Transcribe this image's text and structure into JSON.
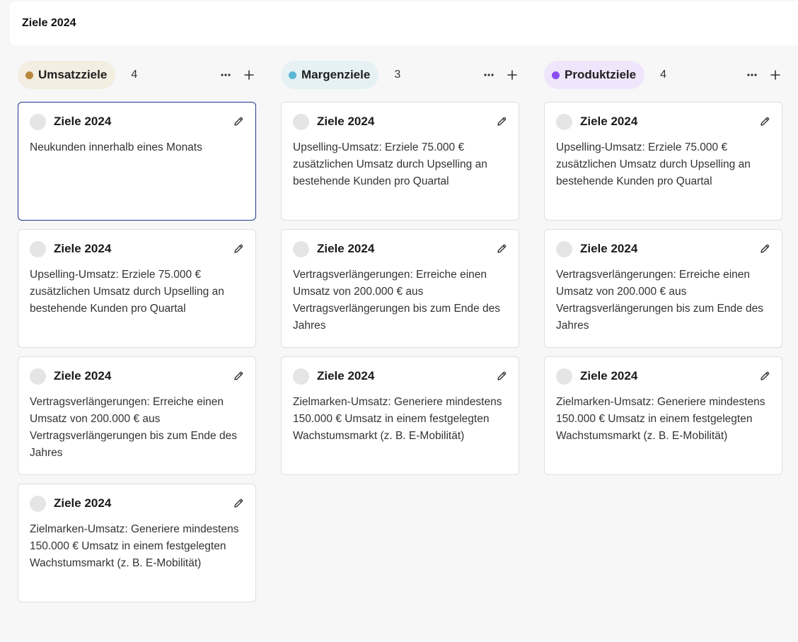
{
  "header": {
    "title": "Ziele 2024"
  },
  "columns": [
    {
      "label": "Umsatzziele",
      "count": "4",
      "dot_color": "#b8893a",
      "chip_bg": "#f3ede2",
      "cards": [
        {
          "title": "Ziele 2024",
          "text": "Neukunden innerhalb eines Monats"
        },
        {
          "title": "Ziele 2024",
          "text": "Upselling-Umsatz: Erziele 75.000 € zusätzlichen Umsatz durch Upselling an bestehende Kunden pro Quartal"
        },
        {
          "title": "Ziele 2024",
          "text": "Vertragsverlängerungen: Erreiche einen Umsatz von 200.000 € aus Vertragsverlängerungen bis zum Ende des Jahres"
        },
        {
          "title": "Ziele 2024",
          "text": "Zielmarken-Umsatz: Generiere mindestens 150.000 € Umsatz in einem festgelegten Wachstumsmarkt (z. B. E-Mobilität)"
        }
      ]
    },
    {
      "label": "Margenziele",
      "count": "3",
      "dot_color": "#5ab8d4",
      "chip_bg": "#e5f1f3",
      "cards": [
        {
          "title": "Ziele 2024",
          "text": "Upselling-Umsatz: Erziele 75.000 € zusätzlichen Umsatz durch Upselling an bestehende Kunden pro Quartal"
        },
        {
          "title": "Ziele 2024",
          "text": "Vertragsverlängerungen: Erreiche einen Umsatz von 200.000 € aus Vertragsverlängerungen bis zum Ende des Jahres"
        },
        {
          "title": "Ziele 2024",
          "text": "Zielmarken-Umsatz: Generiere mindestens 150.000 € Umsatz in einem festgelegten Wachstumsmarkt (z. B. E-Mobilität)"
        }
      ]
    },
    {
      "label": "Produktziele",
      "count": "4",
      "dot_color": "#8b4cf0",
      "chip_bg": "#efe6fb",
      "cards": [
        {
          "title": "Ziele 2024",
          "text": "Upselling-Umsatz: Erziele 75.000 € zusätzlichen Umsatz durch Upselling an bestehende Kunden pro Quartal"
        },
        {
          "title": "Ziele 2024",
          "text": "Vertragsverlängerungen: Erreiche einen Umsatz von 200.000 € aus Vertragsverlängerungen bis zum Ende des Jahres"
        },
        {
          "title": "Ziele 2024",
          "text": "Zielmarken-Umsatz: Generiere mindestens 150.000 € Umsatz in einem festgelegten Wachstumsmarkt (z. B. E-Mobilität)"
        }
      ]
    }
  ],
  "icons": {
    "more": "more-horizontal-icon",
    "add": "plus-icon",
    "edit": "pencil-icon"
  }
}
